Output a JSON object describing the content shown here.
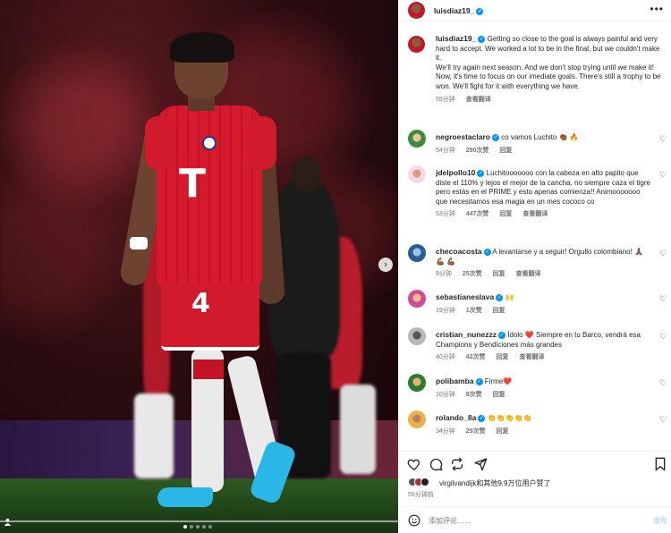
{
  "post": {
    "author": "luisdiaz19_",
    "photo_count": 5,
    "active_photo": 1
  },
  "header": {
    "username": "luisdiaz19_",
    "more_icon": "more-horizontal-icon"
  },
  "caption": {
    "username": "luisdiaz19_",
    "text_line1": "Getting so close to the goal is always painful and very hard to accept. We worked a lot to be in the final, but we couldn't make it.",
    "text_line2": "We'll try again next season. And we don't stop trying until we make it!",
    "text_line3": "Now, it's time to focus on our imediate goals. There's still a trophy to be won. We'll fight for it with everything we have.",
    "time": "55分钟",
    "translate": "查看翻译"
  },
  "comments": [
    {
      "username": "negroestaclaro",
      "text": "co vamos Luchito 👏🏾 🔥",
      "time": "54分钟",
      "likes": "290次赞",
      "reply": "回复",
      "translate": ""
    },
    {
      "username": "jdelpollo10",
      "text": "Luchitooooooo con la cabeza en alto papito que diste el 110% y lejos el mejor de la cancha, no siempre caza el tigre pero estás en el PRIME y esto apenas comienza!! Animooooooo que necesitamos esa magia en un mes cococo co",
      "time": "53分钟",
      "likes": "447次赞",
      "reply": "回复",
      "translate": "查看翻译"
    },
    {
      "username": "checoacosta",
      "text": "A levantarse y a seguir! Orgullo colombiano! 🙏🏾 💪🏾 💪🏾",
      "time": "9分钟",
      "likes": "25次赞",
      "reply": "回复",
      "translate": "查看翻译"
    },
    {
      "username": "sebastianeslava",
      "text": "🙌",
      "time": "19分钟",
      "likes": "1次赞",
      "reply": "回复",
      "translate": ""
    },
    {
      "username": "cristian_nunezzz",
      "text": "Ídolo ❤️ Siempre en tu Barco, vendrá esa Champions y Bendiciones más grandes",
      "time": "40分钟",
      "likes": "42次赞",
      "reply": "回复",
      "translate": "查看翻译"
    },
    {
      "username": "polibamba",
      "text": "Firme❤️",
      "time": "10分钟",
      "likes": "8次赞",
      "reply": "回复",
      "translate": ""
    },
    {
      "username": "rolando_8a",
      "text": "👏👏👏👏👏",
      "time": "34分钟",
      "likes": "29次赞",
      "reply": "回复",
      "translate": ""
    }
  ],
  "likes": {
    "text": "virgilvandijk和其他9.9万位用户赞了"
  },
  "time_ago": "55分钟前",
  "add_comment": {
    "placeholder": "添加评论……",
    "post_label": "发布"
  },
  "colors": {
    "verified": "#0095f6",
    "post_button_disabled": "#b2dffc",
    "secondary_text": "#737373"
  }
}
